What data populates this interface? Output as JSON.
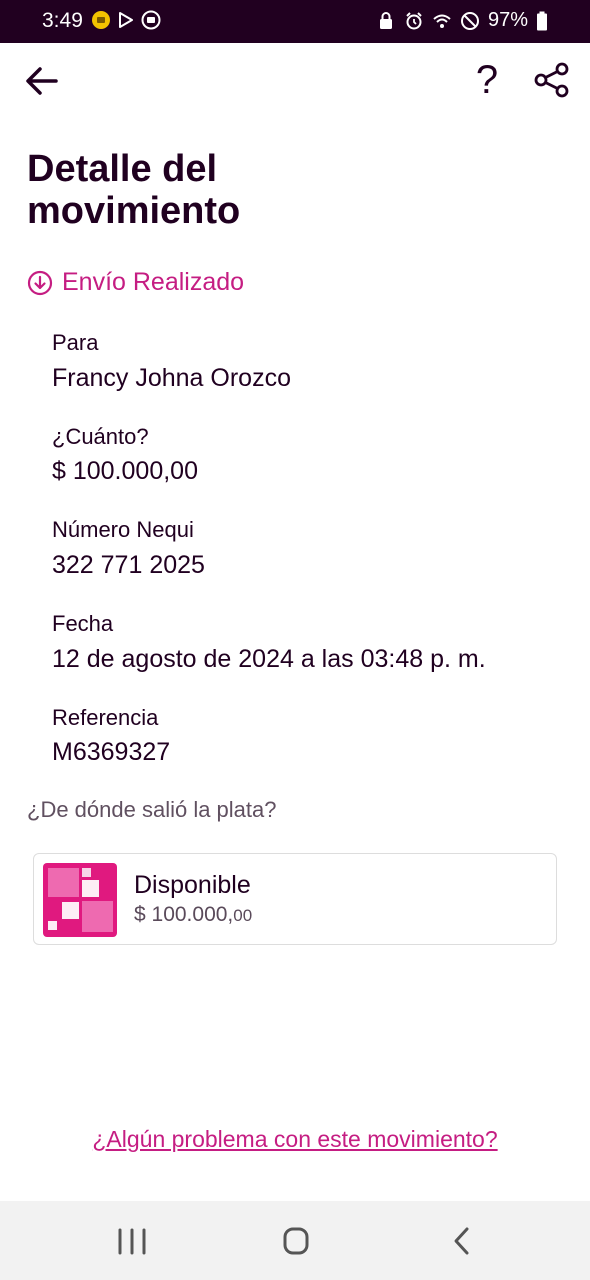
{
  "status_bar": {
    "time": "3:49",
    "battery": "97%"
  },
  "header": {
    "back_icon": "arrow-left-icon",
    "help_label": "?",
    "share_icon": "share-icon"
  },
  "page": {
    "title": "Detalle del movimiento",
    "status": "Envío Realizado",
    "status_color": "#c51d82"
  },
  "fields": [
    {
      "label": "Para",
      "value": "Francy Johna Orozco"
    },
    {
      "label": "¿Cuánto?",
      "value": "$ 100.000,00"
    },
    {
      "label": "Número Nequi",
      "value": "322 771 2025"
    },
    {
      "label": "Fecha",
      "value": "12 de agosto de 2024 a las 03:48 p. m."
    },
    {
      "label": "Referencia",
      "value": "M6369327"
    }
  ],
  "source": {
    "question": "¿De dónde salió la plata?",
    "pocket_name": "Disponible",
    "pocket_amount_main": "$ 100.000,",
    "pocket_amount_cents": "00"
  },
  "footer": {
    "problem_link": "¿Algún problema con este movimiento?"
  },
  "colors": {
    "brand_dark": "#210020",
    "brand_pink": "#c51d82"
  }
}
